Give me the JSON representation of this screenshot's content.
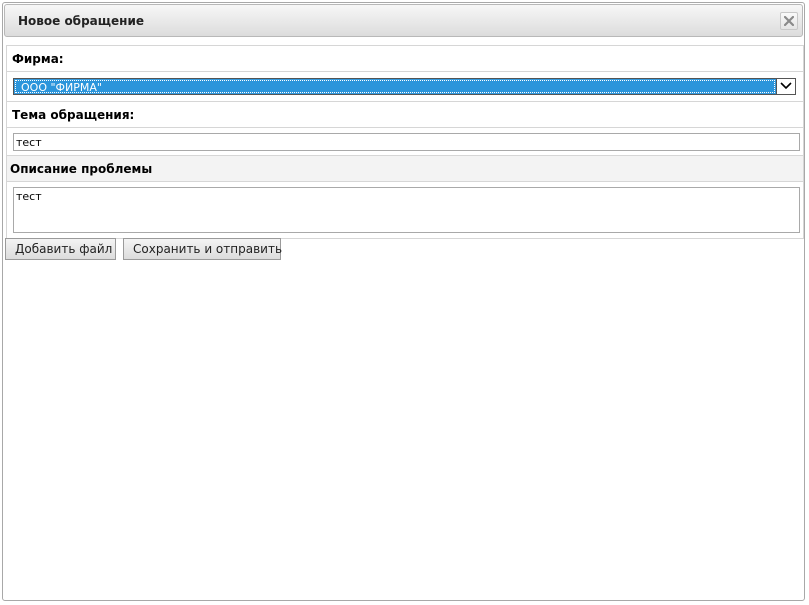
{
  "dialog": {
    "title": "Новое обращение",
    "close_icon": "close-icon"
  },
  "form": {
    "firm": {
      "label": "Фирма:",
      "selected": "ООО \"ФИРМА\""
    },
    "subject": {
      "label": "Тема обращения:",
      "value": "тест"
    },
    "description": {
      "label": "Описание проблемы",
      "value": "тест"
    }
  },
  "actions": {
    "add_file_label": "Добавить файл",
    "save_send_label": "Сохранить и отправить"
  },
  "colors": {
    "select_highlight": "#2b95db",
    "titlebar_top": "#f7f7f7",
    "titlebar_bottom": "#dcdcdc"
  }
}
